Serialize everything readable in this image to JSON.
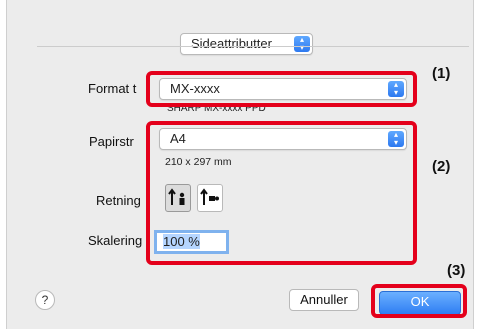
{
  "header": {
    "panel_popup": "Sideattributter"
  },
  "format": {
    "label": "Format t",
    "value": "MX-xxxx",
    "subtext": "SHARP MX-xxxx PPD"
  },
  "paper": {
    "label": "Papirstr",
    "value": "A4",
    "dimensions": "210 x 297 mm"
  },
  "orientation": {
    "label": "Retning",
    "options": [
      "portrait",
      "landscape"
    ],
    "selected": "portrait"
  },
  "scale": {
    "label": "Skalering",
    "value": "100 %"
  },
  "footer": {
    "help_label": "?",
    "cancel_label": "Annuller",
    "ok_label": "OK"
  },
  "callouts": [
    "(1)",
    "(2)",
    "(3)"
  ],
  "colors": {
    "callout": "#e4001b",
    "accent": "#2f7ef3",
    "dialog_bg": "#ececec"
  },
  "icons": {
    "stepper": "up-down-chevron-icon",
    "portrait": "portrait-orientation-icon",
    "landscape": "landscape-orientation-icon"
  }
}
